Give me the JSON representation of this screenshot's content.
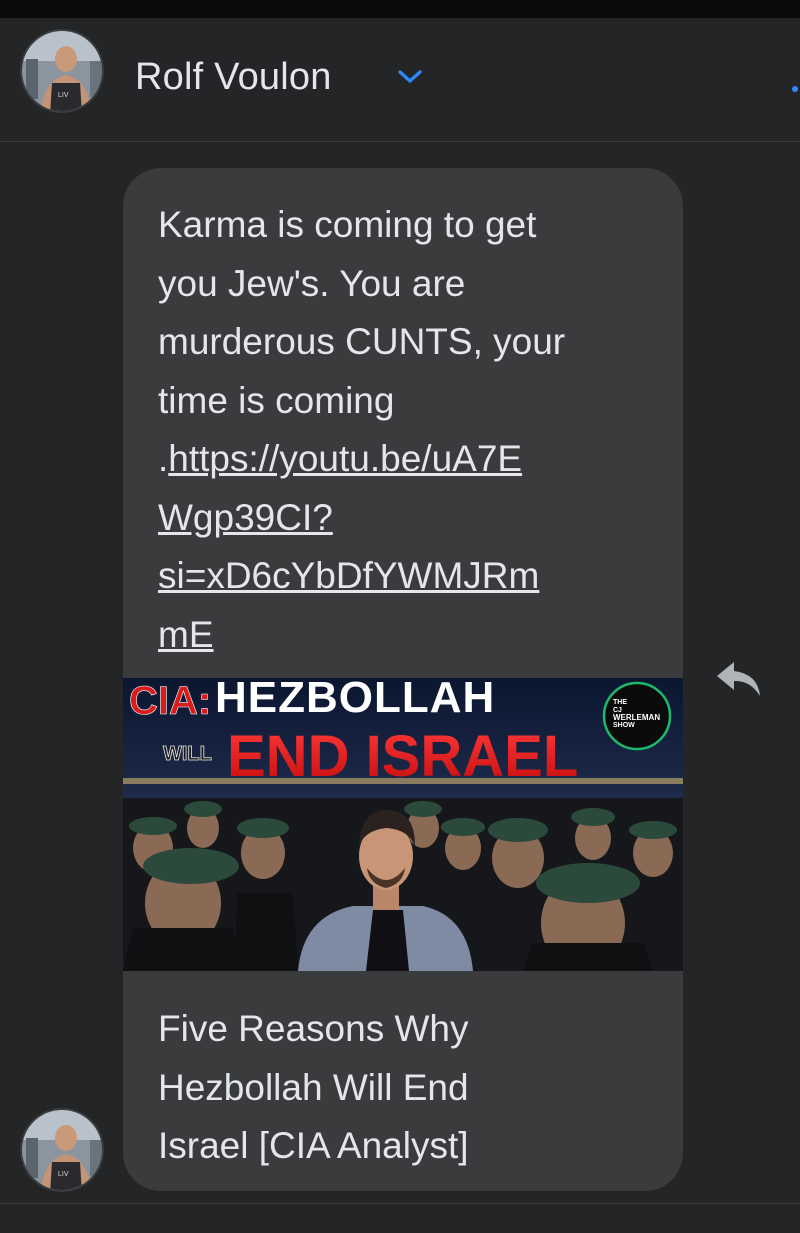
{
  "header": {
    "contact_name": "Rolf Voulon"
  },
  "message": {
    "text_lines": [
      "Karma is coming  to get",
      "you Jew's. You are",
      "murderous CUNTS, your",
      "time is coming"
    ],
    "link_prefix": ".",
    "link_lines": [
      "https://youtu.be/uA7E",
      "Wgp39CI?",
      "si=xD6cYbDfYWMJRm",
      "mE"
    ]
  },
  "link_preview": {
    "thumbnail": {
      "cia_label": "CIA:",
      "headline_top": "HEZBOLLAH",
      "will_label": "WILL",
      "headline_main": "END ISRAEL",
      "badge_lines": [
        "THE",
        "CJ",
        "WERLEMAN",
        "SHOW"
      ]
    },
    "title_lines": [
      "Five Reasons Why",
      "Hezbollah Will End",
      "Israel [CIA Analyst]"
    ]
  },
  "icons": {
    "chevron": "chevron-down-icon",
    "reply": "reply-icon"
  },
  "colors": {
    "background": "#242526",
    "bubble": "#3a3b3c",
    "accent": "#2e89ff",
    "text": "#e4e6eb"
  }
}
